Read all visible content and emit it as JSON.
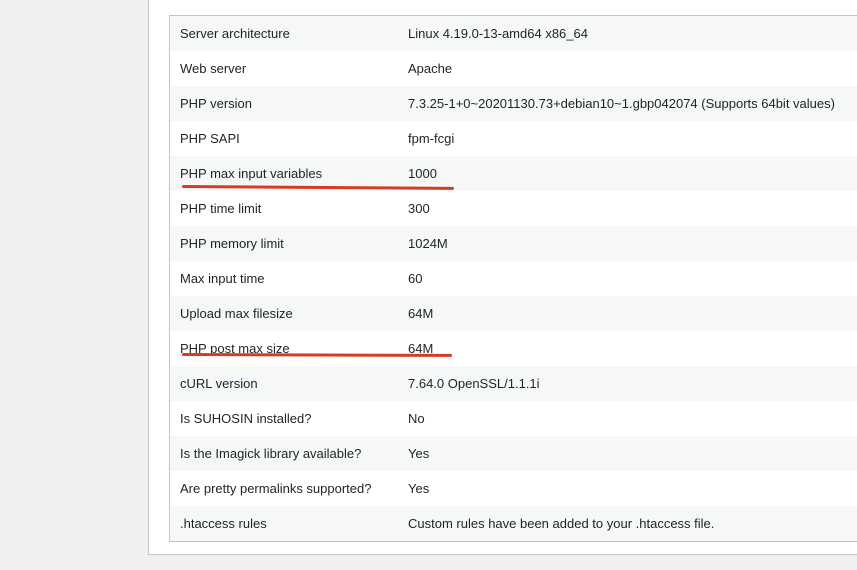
{
  "system_info": {
    "rows": [
      {
        "label": "Server architecture",
        "value": "Linux 4.19.0-13-amd64 x86_64"
      },
      {
        "label": "Web server",
        "value": "Apache"
      },
      {
        "label": "PHP version",
        "value": "7.3.25-1+0~20201130.73+debian10~1.gbp042074 (Supports 64bit values)"
      },
      {
        "label": "PHP SAPI",
        "value": "fpm-fcgi"
      },
      {
        "label": "PHP max input variables",
        "value": "1000"
      },
      {
        "label": "PHP time limit",
        "value": "300"
      },
      {
        "label": "PHP memory limit",
        "value": "1024M"
      },
      {
        "label": "Max input time",
        "value": "60"
      },
      {
        "label": "Upload max filesize",
        "value": "64M"
      },
      {
        "label": "PHP post max size",
        "value": "64M"
      },
      {
        "label": "cURL version",
        "value": "7.64.0 OpenSSL/1.1.1i"
      },
      {
        "label": "Is SUHOSIN installed?",
        "value": "No"
      },
      {
        "label": "Is the Imagick library available?",
        "value": "Yes"
      },
      {
        "label": "Are pretty permalinks supported?",
        "value": "Yes"
      },
      {
        "label": ".htaccess rules",
        "value": "Custom rules have been added to your .htaccess file."
      }
    ]
  },
  "annotations": {
    "underline_color": "#d63c24"
  }
}
